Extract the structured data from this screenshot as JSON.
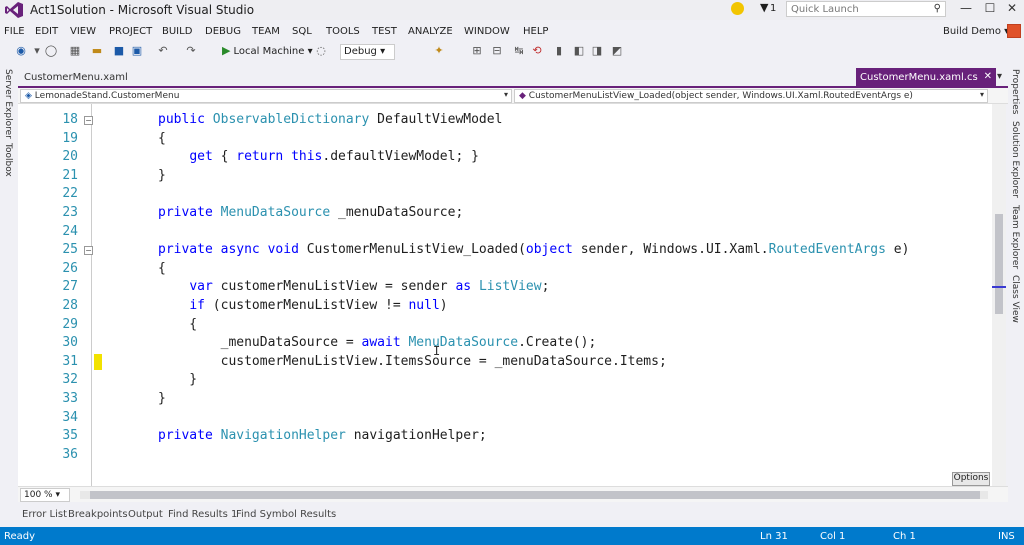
{
  "window": {
    "title": "Act1Solution - Microsoft Visual Studio",
    "quick_launch_placeholder": "Quick Launch",
    "notification_count": "1",
    "user": "Build Demo",
    "user_dropdown": "Build Demo ▾"
  },
  "menu": [
    "FILE",
    "EDIT",
    "VIEW",
    "PROJECT",
    "BUILD",
    "DEBUG",
    "TEAM",
    "SQL",
    "TOOLS",
    "TEST",
    "ANALYZE",
    "WINDOW",
    "HELP"
  ],
  "toolbar": {
    "run_label": "Local Machine",
    "config": "Debug"
  },
  "side_panels": {
    "left": [
      "Server Explorer",
      "Toolbox"
    ],
    "right": [
      "Properties",
      "Solution Explorer",
      "Team Explorer",
      "Class View"
    ]
  },
  "tabs": {
    "inactive": "CustomerMenu.xaml",
    "active": "CustomerMenu.xaml.cs"
  },
  "navbar": {
    "class": "LemonadeStand.CustomerMenu",
    "member": "CustomerMenuListView_Loaded(object sender, Windows.UI.Xaml.RoutedEventArgs e)"
  },
  "code": {
    "lines": [
      {
        "n": "18",
        "t": "public ObservableDictionary DefaultViewModel"
      },
      {
        "n": "19",
        "t": "{"
      },
      {
        "n": "20",
        "t": "    get { return this.defaultViewModel; }"
      },
      {
        "n": "21",
        "t": "}"
      },
      {
        "n": "22",
        "t": ""
      },
      {
        "n": "23",
        "t": "private MenuDataSource _menuDataSource;"
      },
      {
        "n": "24",
        "t": ""
      },
      {
        "n": "25",
        "t": "private async void CustomerMenuListView_Loaded(object sender, Windows.UI.Xaml.RoutedEventArgs e)"
      },
      {
        "n": "26",
        "t": "{"
      },
      {
        "n": "27",
        "t": "    var customerMenuListView = sender as ListView;"
      },
      {
        "n": "28",
        "t": "    if (customerMenuListView != null)"
      },
      {
        "n": "29",
        "t": "    {"
      },
      {
        "n": "30",
        "t": "        _menuDataSource = await MenuDataSource.Create();"
      },
      {
        "n": "31",
        "t": "        customerMenuListView.ItemsSource = _menuDataSource.Items;"
      },
      {
        "n": "32",
        "t": "    }"
      },
      {
        "n": "33",
        "t": "}"
      },
      {
        "n": "34",
        "t": ""
      },
      {
        "n": "35",
        "t": "private NavigationHelper navigationHelper;"
      },
      {
        "n": "36",
        "t": ""
      }
    ],
    "keywords": [
      "public",
      "private",
      "async",
      "void",
      "get",
      "return",
      "this",
      "object",
      "var",
      "as",
      "if",
      "null",
      "await"
    ],
    "types": [
      "ObservableDictionary",
      "MenuDataSource",
      "ListView",
      "RoutedEventArgs",
      "NavigationHelper"
    ]
  },
  "editor": {
    "zoom": "100 %",
    "options_label": "Options"
  },
  "bottom_tabs": [
    "Error List",
    "Breakpoints",
    "Output",
    "Find Results 1",
    "Find Symbol Results"
  ],
  "status": {
    "state": "Ready",
    "line": "Ln 31",
    "col": "Col 1",
    "ch": "Ch 1",
    "mode": "INS"
  },
  "colors": {
    "accent": "#68217a",
    "statusbar": "#007acc",
    "keyword": "#0000ff",
    "type": "#2b91af"
  }
}
